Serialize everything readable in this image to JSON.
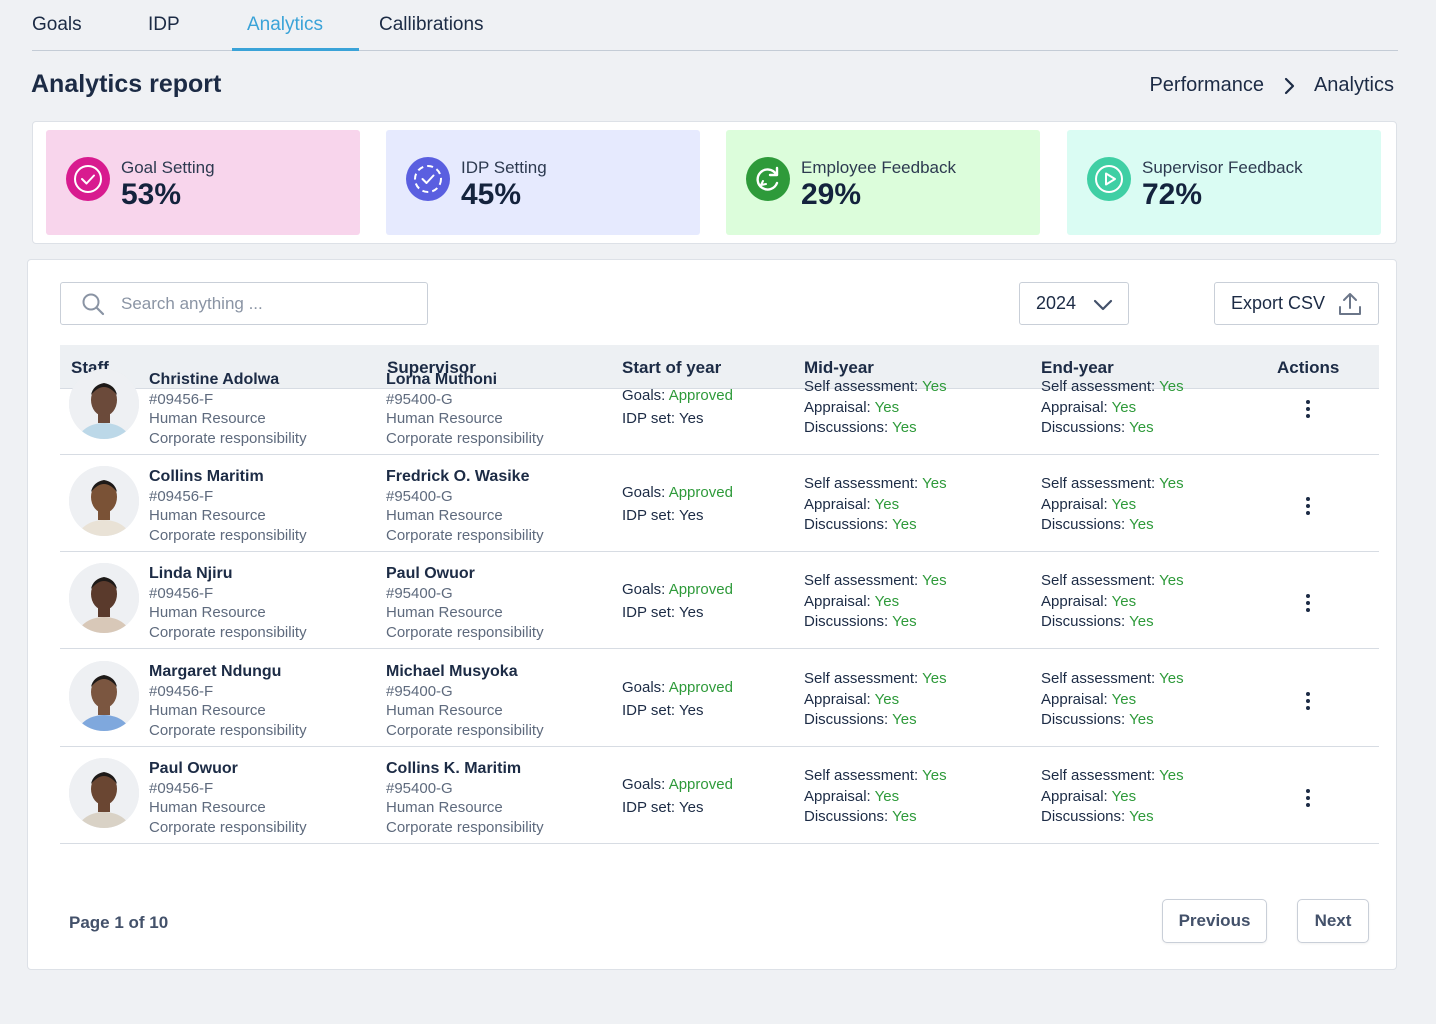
{
  "tabs": [
    {
      "label": "Goals"
    },
    {
      "label": "IDP"
    },
    {
      "label": "Analytics"
    },
    {
      "label": "Callibrations"
    }
  ],
  "active_tab": "Analytics",
  "header": {
    "title": "Analytics report",
    "breadcrumb": [
      "Performance",
      "Analytics"
    ]
  },
  "stats": [
    {
      "label": "Goal Setting",
      "value": "53%",
      "bg": "#f8d5ec",
      "icon_bg": "#d81b8f",
      "icon": "check-circle-icon"
    },
    {
      "label": "IDP Setting",
      "value": "45%",
      "bg": "#e6eafe",
      "icon_bg": "#5a5fe0",
      "icon": "dashed-check-circle-icon"
    },
    {
      "label": "Employee Feedback",
      "value": "29%",
      "bg": "#dcfddb",
      "icon_bg": "#2e9a3a",
      "icon": "refresh-icon"
    },
    {
      "label": "Supervisor Feedback",
      "value": "72%",
      "bg": "#dafcf3",
      "icon_bg": "#3fcfa4",
      "icon": "play-circle-icon"
    }
  ],
  "toolbar": {
    "search_placeholder": "Search anything ...",
    "year": "2024",
    "export_label": "Export CSV"
  },
  "table": {
    "headers": {
      "staff": "Staff",
      "supervisor": "Supervisor",
      "start": "Start of year",
      "mid": "Mid-year",
      "end": "End-year",
      "actions": "Actions"
    },
    "rows": [
      {
        "staff": {
          "name": "Christine Adolwa",
          "id": "#09456-F",
          "dept": "Human Resource",
          "unit": "Corporate responsibility"
        },
        "supervisor": {
          "name": "Lorna Muthoni",
          "id": "#95400-G",
          "dept": "Human Resource",
          "unit": "Corporate responsibility"
        },
        "start": {
          "goals_label": "Goals:",
          "goals": "Approved",
          "idp_label": "IDP set:",
          "idp": "Yes"
        },
        "mid": {
          "self_label": "Self assessment:",
          "self": "Yes",
          "appraisal_label": "Appraisal:",
          "appraisal": "Yes",
          "disc_label": "Discussions:",
          "disc": "Yes"
        },
        "end": {
          "self_label": "Self assessment:",
          "self": "Yes",
          "appraisal_label": "Appraisal:",
          "appraisal": "Yes",
          "disc_label": "Discussions:",
          "disc": "Yes"
        }
      },
      {
        "staff": {
          "name": "Collins Maritim",
          "id": "#09456-F",
          "dept": "Human Resource",
          "unit": "Corporate responsibility"
        },
        "supervisor": {
          "name": "Fredrick O. Wasike",
          "id": "#95400-G",
          "dept": "Human Resource",
          "unit": "Corporate responsibility"
        },
        "start": {
          "goals_label": "Goals:",
          "goals": "Approved",
          "idp_label": "IDP set:",
          "idp": "Yes"
        },
        "mid": {
          "self_label": "Self assessment:",
          "self": "Yes",
          "appraisal_label": "Appraisal:",
          "appraisal": "Yes",
          "disc_label": "Discussions:",
          "disc": "Yes"
        },
        "end": {
          "self_label": "Self assessment:",
          "self": "Yes",
          "appraisal_label": "Appraisal:",
          "appraisal": "Yes",
          "disc_label": "Discussions:",
          "disc": "Yes"
        }
      },
      {
        "staff": {
          "name": "Linda Njiru",
          "id": "#09456-F",
          "dept": "Human Resource",
          "unit": "Corporate responsibility"
        },
        "supervisor": {
          "name": "Paul Owuor",
          "id": "#95400-G",
          "dept": "Human Resource",
          "unit": "Corporate responsibility"
        },
        "start": {
          "goals_label": "Goals:",
          "goals": "Approved",
          "idp_label": "IDP set:",
          "idp": "Yes"
        },
        "mid": {
          "self_label": "Self assessment:",
          "self": "Yes",
          "appraisal_label": "Appraisal:",
          "appraisal": "Yes",
          "disc_label": "Discussions:",
          "disc": "Yes"
        },
        "end": {
          "self_label": "Self assessment:",
          "self": "Yes",
          "appraisal_label": "Appraisal:",
          "appraisal": "Yes",
          "disc_label": "Discussions:",
          "disc": "Yes"
        }
      },
      {
        "staff": {
          "name": "Margaret Ndungu",
          "id": "#09456-F",
          "dept": "Human Resource",
          "unit": "Corporate responsibility"
        },
        "supervisor": {
          "name": "Michael Musyoka",
          "id": "#95400-G",
          "dept": "Human Resource",
          "unit": "Corporate responsibility"
        },
        "start": {
          "goals_label": "Goals:",
          "goals": "Approved",
          "idp_label": "IDP set:",
          "idp": "Yes"
        },
        "mid": {
          "self_label": "Self assessment:",
          "self": "Yes",
          "appraisal_label": "Appraisal:",
          "appraisal": "Yes",
          "disc_label": "Discussions:",
          "disc": "Yes"
        },
        "end": {
          "self_label": "Self assessment:",
          "self": "Yes",
          "appraisal_label": "Appraisal:",
          "appraisal": "Yes",
          "disc_label": "Discussions:",
          "disc": "Yes"
        }
      },
      {
        "staff": {
          "name": "Paul Owuor",
          "id": "#09456-F",
          "dept": "Human Resource",
          "unit": "Corporate responsibility"
        },
        "supervisor": {
          "name": "Collins K. Maritim",
          "id": "#95400-G",
          "dept": "Human Resource",
          "unit": "Corporate responsibility"
        },
        "start": {
          "goals_label": "Goals:",
          "goals": "Approved",
          "idp_label": "IDP set:",
          "idp": "Yes"
        },
        "mid": {
          "self_label": "Self assessment:",
          "self": "Yes",
          "appraisal_label": "Appraisal:",
          "appraisal": "Yes",
          "disc_label": "Discussions:",
          "disc": "Yes"
        },
        "end": {
          "self_label": "Self assessment:",
          "self": "Yes",
          "appraisal_label": "Appraisal:",
          "appraisal": "Yes",
          "disc_label": "Discussions:",
          "disc": "Yes"
        }
      }
    ]
  },
  "pagination": {
    "info": "Page 1 of 10",
    "previous": "Previous",
    "next": "Next"
  },
  "colors": {
    "accent": "#3aa3d8",
    "status_green": "#2e9a3a",
    "text_dark": "#1c2b45"
  }
}
